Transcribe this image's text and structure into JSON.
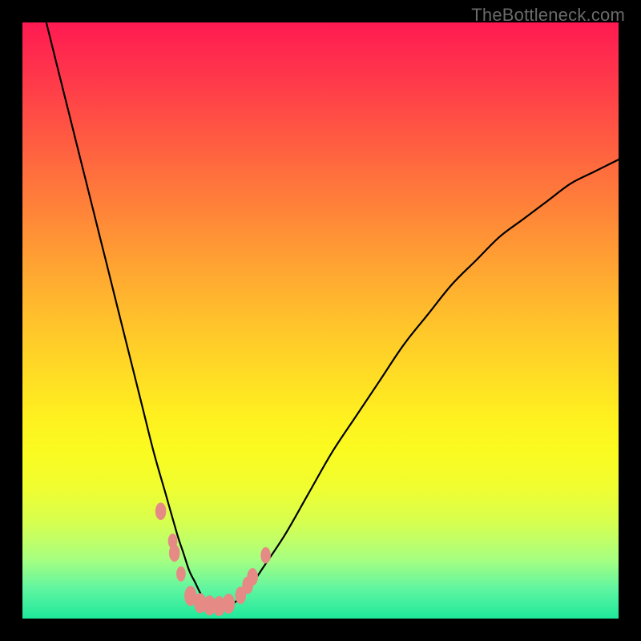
{
  "watermark": "TheBottleneck.com",
  "colors": {
    "frame": "#000000",
    "curve_stroke": "#000000",
    "marker_fill": "#e58a84",
    "marker_stroke": "#e58a84"
  },
  "chart_data": {
    "type": "line",
    "title": "",
    "xlabel": "",
    "ylabel": "",
    "xlim": [
      0,
      100
    ],
    "ylim": [
      0,
      100
    ],
    "grid": false,
    "legend": false,
    "note": "No axis ticks or numeric labels are rendered. Values below are normalized 0–100 for both axes, read off the pixel positions; y=0 is bottom of plot area.",
    "series": [
      {
        "name": "curve",
        "x": [
          4,
          6,
          8,
          10,
          12,
          14,
          16,
          18,
          20,
          22,
          24,
          26,
          27,
          28,
          29,
          30,
          31,
          32,
          33,
          34,
          36,
          38,
          40,
          44,
          48,
          52,
          56,
          60,
          64,
          68,
          72,
          76,
          80,
          84,
          88,
          92,
          96,
          100
        ],
        "y": [
          100,
          92,
          84,
          76,
          68,
          60,
          52,
          44,
          36,
          28,
          21,
          14,
          11,
          8,
          6,
          4,
          3,
          2,
          2,
          2,
          3,
          5,
          8,
          14,
          21,
          28,
          34,
          40,
          46,
          51,
          56,
          60,
          64,
          67,
          70,
          73,
          75,
          77
        ]
      }
    ],
    "markers": [
      {
        "x": 23.2,
        "y": 18.0,
        "r": 1.4
      },
      {
        "x": 25.2,
        "y": 13.0,
        "r": 1.2
      },
      {
        "x": 25.5,
        "y": 11.0,
        "r": 1.4
      },
      {
        "x": 26.6,
        "y": 7.5,
        "r": 1.2
      },
      {
        "x": 28.2,
        "y": 3.8,
        "r": 1.6
      },
      {
        "x": 29.8,
        "y": 2.6,
        "r": 1.6
      },
      {
        "x": 31.4,
        "y": 2.2,
        "r": 1.6
      },
      {
        "x": 33.0,
        "y": 2.1,
        "r": 1.6
      },
      {
        "x": 34.6,
        "y": 2.5,
        "r": 1.6
      },
      {
        "x": 36.6,
        "y": 3.9,
        "r": 1.4
      },
      {
        "x": 37.8,
        "y": 5.6,
        "r": 1.4
      },
      {
        "x": 38.6,
        "y": 7.0,
        "r": 1.4
      },
      {
        "x": 40.8,
        "y": 10.6,
        "r": 1.3
      }
    ],
    "gradient_stops": [
      {
        "pos": 0.0,
        "color": "#ff1a52"
      },
      {
        "pos": 0.1,
        "color": "#ff3a4a"
      },
      {
        "pos": 0.24,
        "color": "#ff6a3e"
      },
      {
        "pos": 0.38,
        "color": "#ff9a34"
      },
      {
        "pos": 0.52,
        "color": "#ffc82a"
      },
      {
        "pos": 0.66,
        "color": "#fff020"
      },
      {
        "pos": 0.72,
        "color": "#fafb20"
      },
      {
        "pos": 0.78,
        "color": "#f0fd30"
      },
      {
        "pos": 0.84,
        "color": "#d6ff50"
      },
      {
        "pos": 0.9,
        "color": "#a8ff80"
      },
      {
        "pos": 0.95,
        "color": "#60f5a0"
      },
      {
        "pos": 1.0,
        "color": "#1ee89b"
      }
    ]
  }
}
